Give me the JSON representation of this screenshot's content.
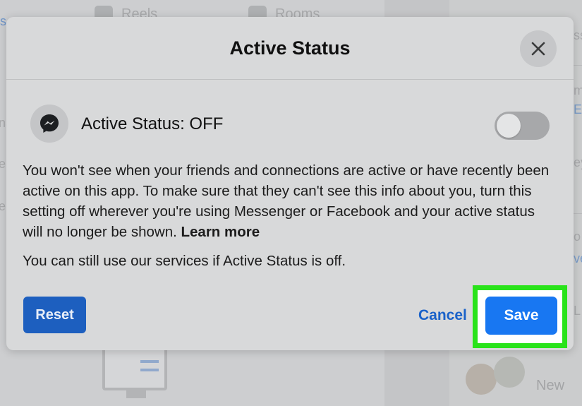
{
  "background": {
    "tabs": [
      {
        "label": "Reels"
      },
      {
        "label": "Rooms"
      }
    ],
    "left_fragment": "s",
    "side_fragments": [
      "na",
      "e",
      "ep"
    ],
    "right_fragments": [
      "ss",
      "m",
      "Ev",
      "ey",
      "o",
      "ve",
      "L"
    ],
    "new_label": "New"
  },
  "modal": {
    "title": "Active Status",
    "status_label": "Active Status: OFF",
    "toggle_on": false,
    "description": "You won't see when your friends and connections are active or have recently been active on this app. To make sure that they can't see this info about you, turn this setting off wherever you're using Messenger or Facebook and your active status will no longer be shown.",
    "learn_more": "Learn more",
    "note": "You can still use our services if Active Status is off.",
    "reset_label": "Reset",
    "cancel_label": "Cancel",
    "save_label": "Save"
  },
  "colors": {
    "primary": "#1877f2",
    "link": "#1a62c9",
    "highlight": "#29e31a"
  },
  "icons": {
    "close": "close-icon",
    "messenger": "messenger-icon"
  }
}
